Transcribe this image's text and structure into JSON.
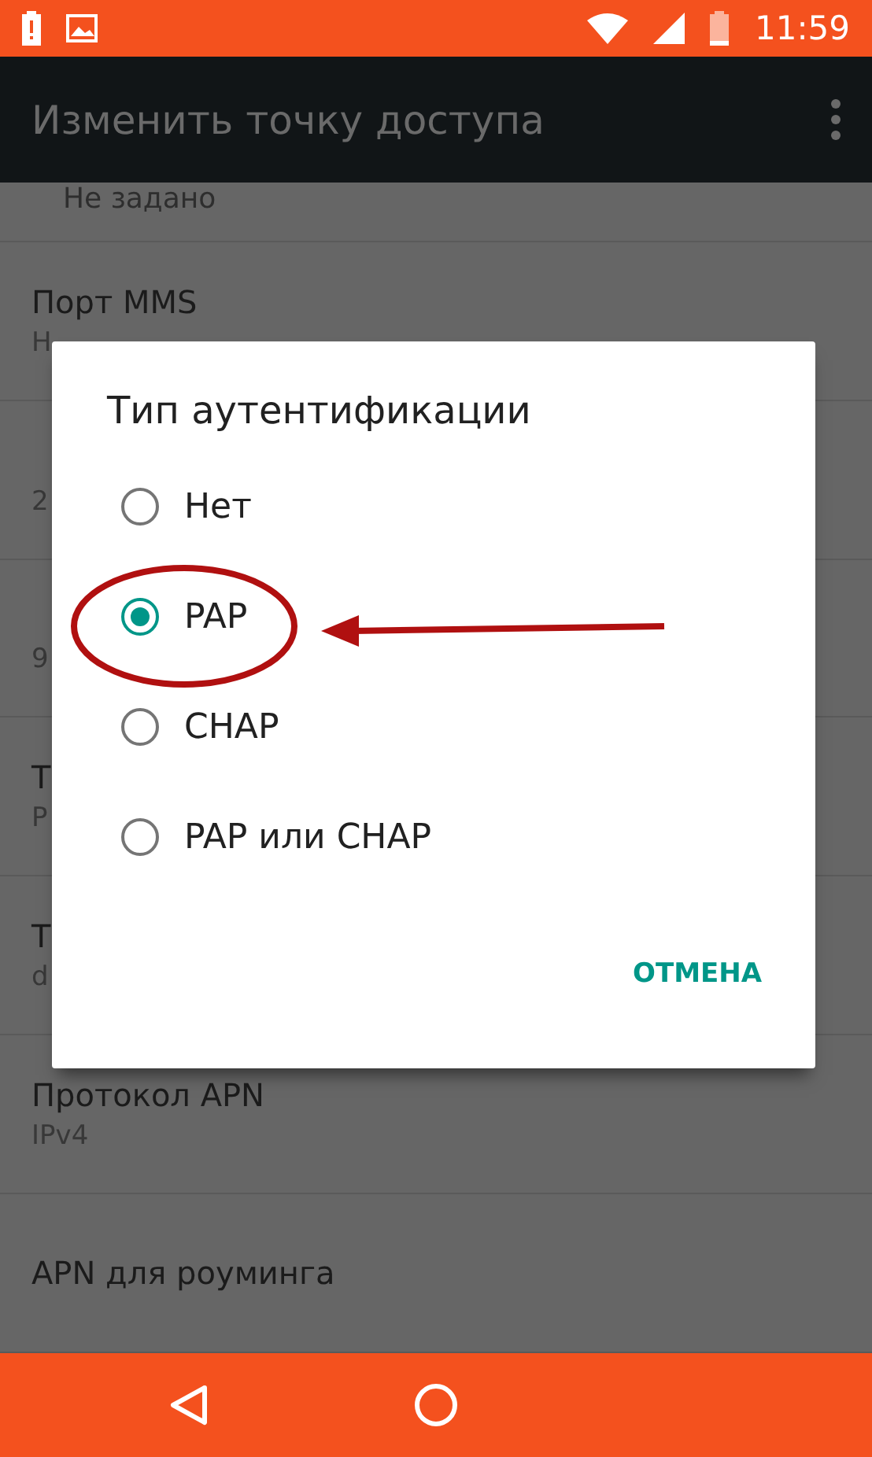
{
  "status_bar": {
    "time": "11:59"
  },
  "app_bar": {
    "title": "Изменить точку доступа"
  },
  "top_value": "Не задано",
  "settings": [
    {
      "title": "Порт MMS",
      "value": "Н"
    },
    {
      "value": "2"
    },
    {
      "value": "9"
    },
    {
      "title": "Т",
      "value": "P"
    },
    {
      "title": "Т",
      "value": "d"
    },
    {
      "title": "Протокол APN",
      "value": "IPv4"
    },
    {
      "title": "APN для роуминга"
    }
  ],
  "dialog": {
    "title": "Тип аутентификации",
    "options": [
      {
        "label": "Нет",
        "selected": false
      },
      {
        "label": "PAP",
        "selected": true
      },
      {
        "label": "CHAP",
        "selected": false
      },
      {
        "label": "PAP или CHAP",
        "selected": false
      }
    ],
    "button": "ОТМЕНА"
  }
}
